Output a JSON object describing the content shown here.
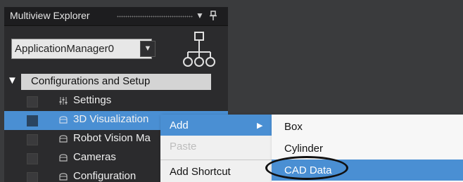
{
  "explorer": {
    "title": "Multiview Explorer",
    "dropdown_icon": "triangle-down",
    "pin_icon": "pin",
    "device_select": {
      "value": "ApplicationManager0"
    },
    "config_section": {
      "label": "Configurations and Setup"
    },
    "items": [
      {
        "label": "Settings",
        "icon": "sliders-icon"
      },
      {
        "label": "3D Visualization",
        "icon": "folder-icon"
      },
      {
        "label": "Robot Vision Ma",
        "icon": "folder-icon"
      },
      {
        "label": "Cameras",
        "icon": "folder-icon"
      },
      {
        "label": "Configuration",
        "icon": "folder-icon"
      }
    ]
  },
  "context_menu": {
    "items": [
      {
        "label": "Add",
        "has_submenu": true
      },
      {
        "label": "Paste",
        "disabled": true
      },
      {
        "label": "Add Shortcut"
      }
    ]
  },
  "submenu": {
    "items": [
      {
        "label": "Box"
      },
      {
        "label": "Cylinder"
      },
      {
        "label": "CAD Data"
      }
    ]
  },
  "colors": {
    "selection": "#4a8fd3",
    "panel": "#2b2b2d",
    "menu": "#f0f0f0"
  }
}
